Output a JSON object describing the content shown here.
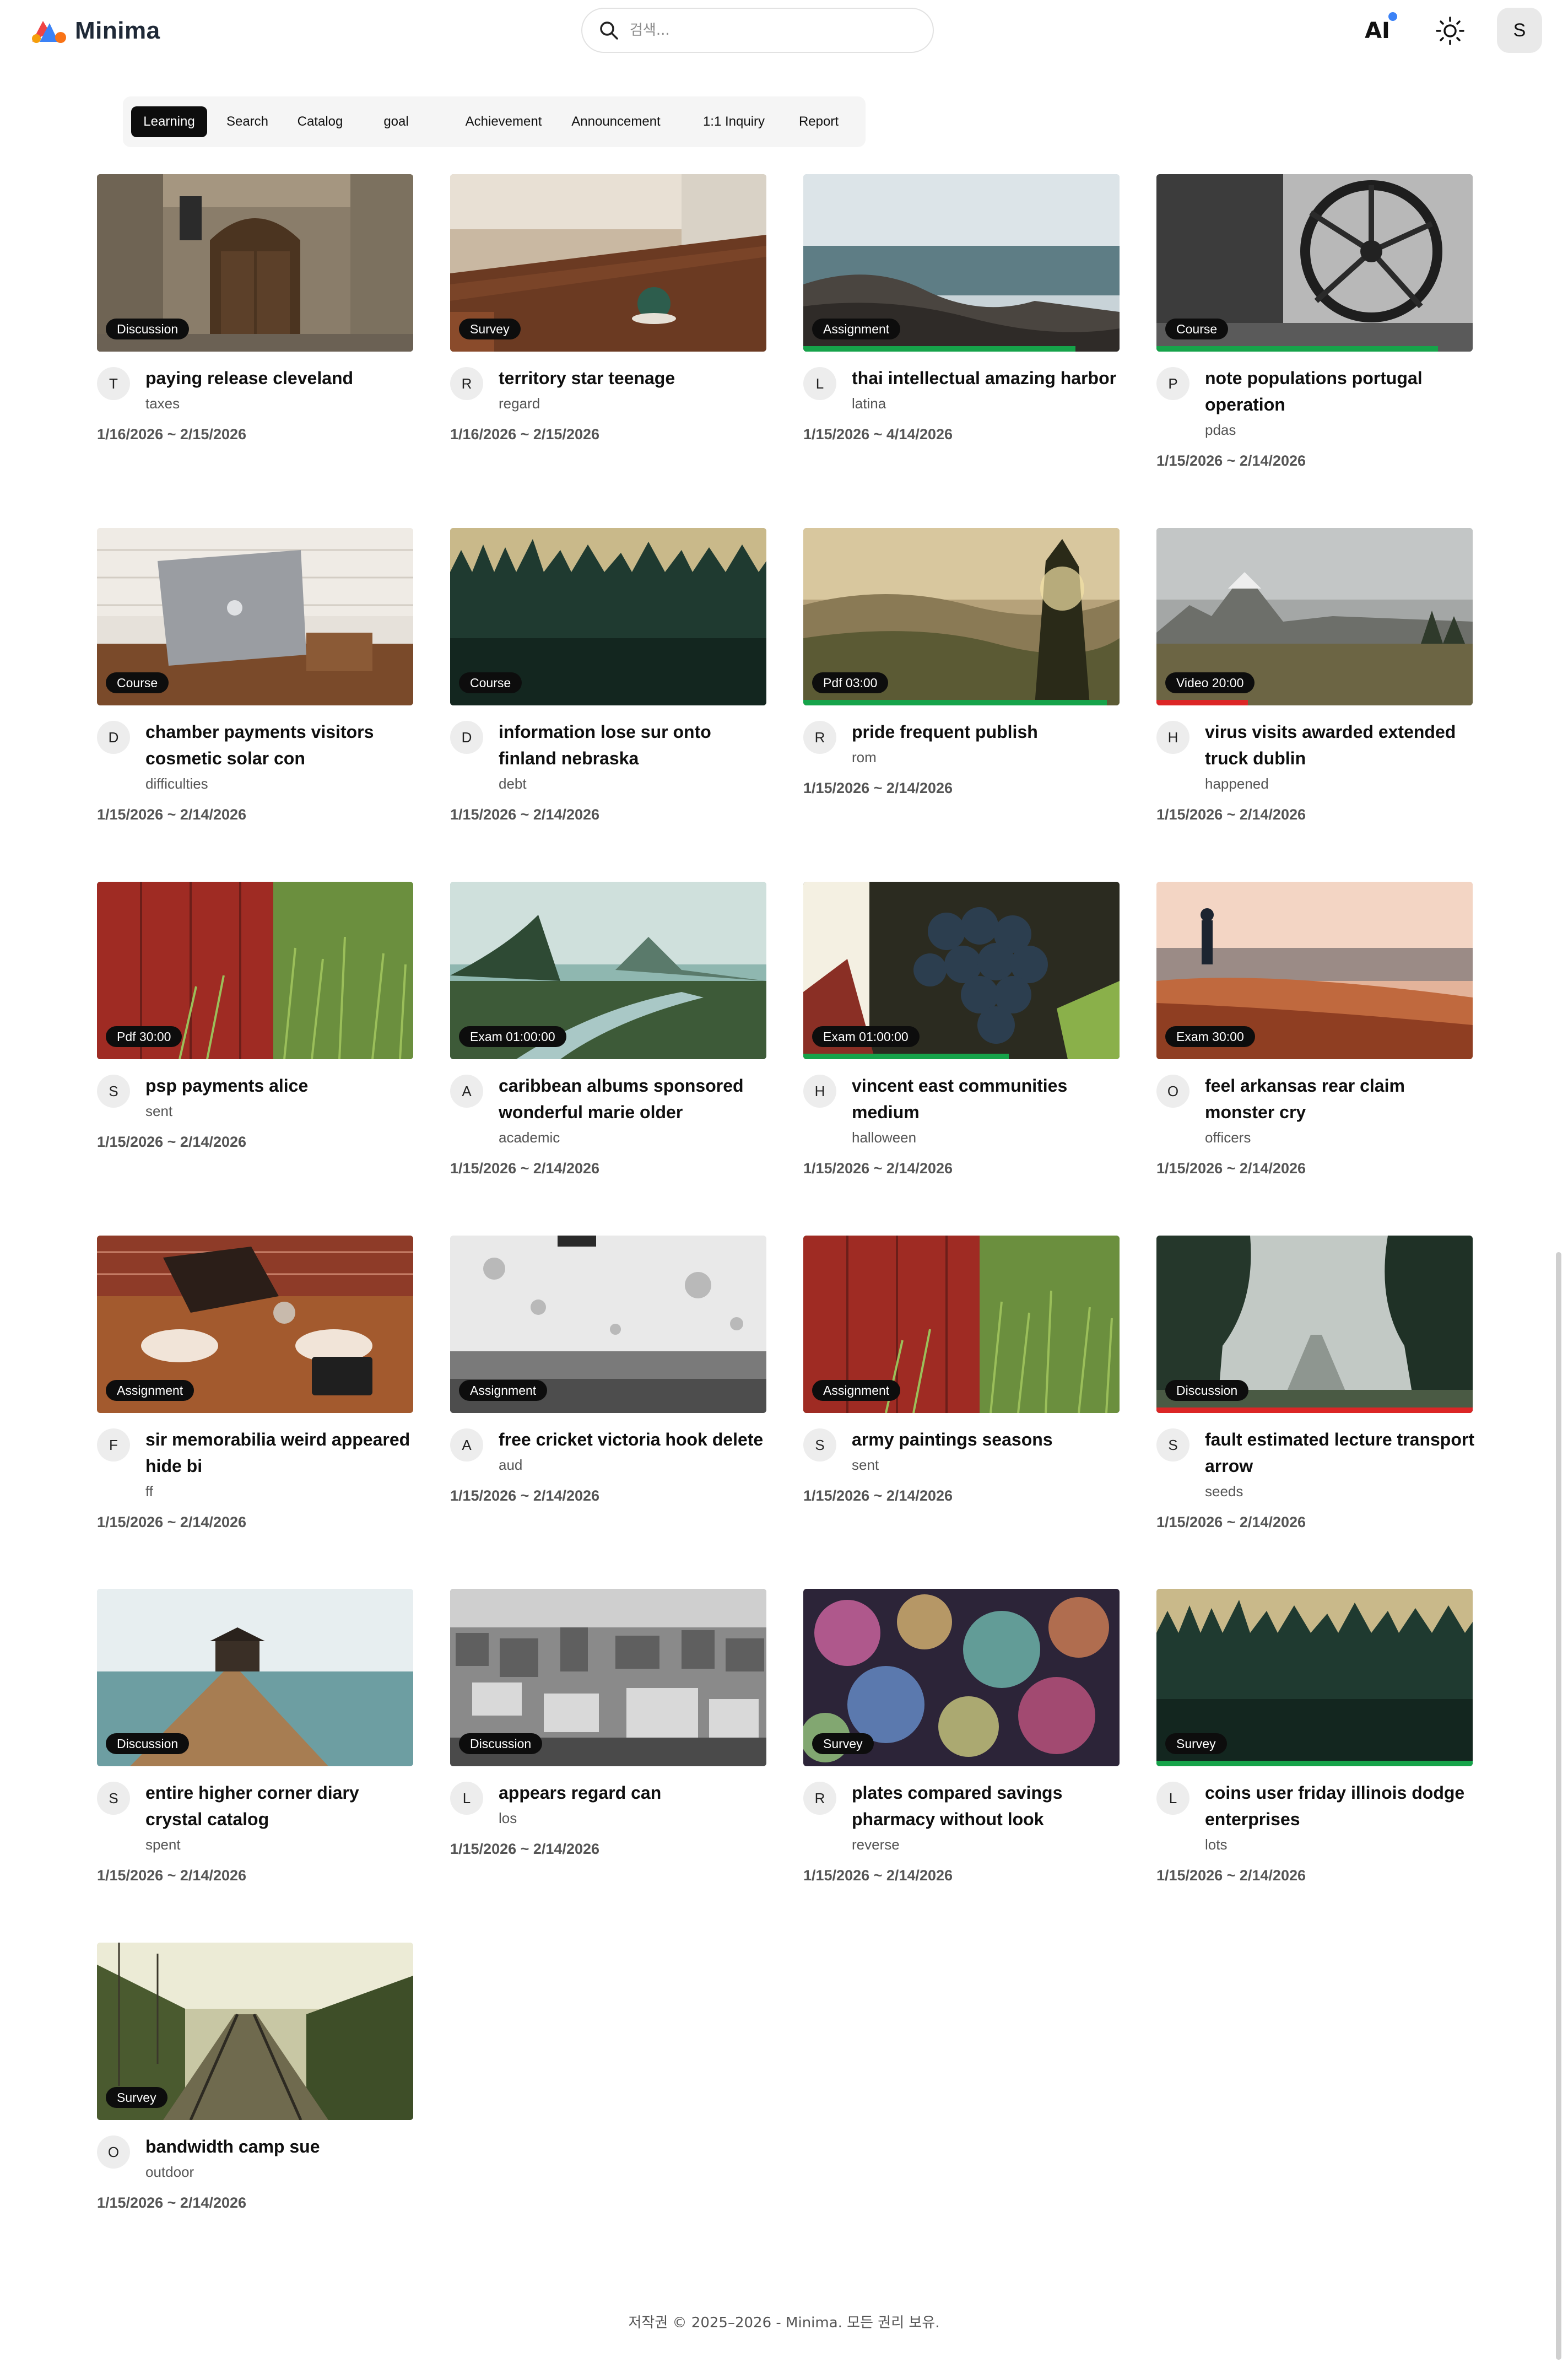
{
  "app": {
    "name": "Minima"
  },
  "search": {
    "placeholder": "검색..."
  },
  "header": {
    "ai_label": "AI",
    "avatar_initial": "S"
  },
  "tabs": [
    {
      "label": "Learning",
      "active": true
    },
    {
      "label": "Search",
      "active": false
    },
    {
      "label": "Catalog",
      "active": false
    },
    {
      "label": "goal",
      "active": false
    },
    {
      "label": "Achievement",
      "active": false
    },
    {
      "label": "Announcement",
      "active": false
    },
    {
      "label": "1:1 Inquiry",
      "active": false
    },
    {
      "label": "Report",
      "active": false
    }
  ],
  "cards": [
    {
      "badge": "Discussion",
      "letter": "T",
      "title": "paying release cleveland",
      "subtitle": "taxes",
      "dates": "1/16/2026 ~ 2/15/2026",
      "image": "door"
    },
    {
      "badge": "Survey",
      "letter": "R",
      "title": "territory star teenage",
      "subtitle": "regard",
      "dates": "1/16/2026 ~ 2/15/2026",
      "image": "cafe"
    },
    {
      "badge": "Assignment",
      "letter": "L",
      "title": "thai intellectual amazing harbor",
      "subtitle": "latina",
      "dates": "1/15/2026 ~ 4/14/2026",
      "image": "sea",
      "progress": 0.86,
      "progress_color": "#16a34a"
    },
    {
      "badge": "Course",
      "letter": "P",
      "title": "note populations portugal operation",
      "subtitle": "pdas",
      "dates": "1/15/2026 ~ 2/14/2026",
      "image": "wheel",
      "progress": 0.89,
      "progress_color": "#16a34a"
    },
    {
      "badge": "Course",
      "letter": "D",
      "title": "chamber payments visitors cosmetic solar con",
      "subtitle": "difficulties",
      "dates": "1/15/2026 ~ 2/14/2026",
      "image": "laptop"
    },
    {
      "badge": "Course",
      "letter": "D",
      "title": "information lose sur onto finland nebraska",
      "subtitle": "debt",
      "dates": "1/15/2026 ~ 2/14/2026",
      "image": "forest"
    },
    {
      "badge": "Pdf  03:00",
      "letter": "R",
      "title": "pride frequent publish",
      "subtitle": "rom",
      "dates": "1/15/2026 ~ 2/14/2026",
      "image": "hills",
      "progress": 0.96,
      "progress_color": "#16a34a"
    },
    {
      "badge": "Video  20:00",
      "letter": "H",
      "title": "virus visits awarded extended truck dublin",
      "subtitle": "happened",
      "dates": "1/15/2026 ~ 2/14/2026",
      "image": "mountain",
      "progress": 0.29,
      "progress_color": "#dc2626"
    },
    {
      "badge": "Pdf  30:00",
      "letter": "S",
      "title": "psp payments alice",
      "subtitle": "sent",
      "dates": "1/15/2026 ~ 2/14/2026",
      "image": "redgrass"
    },
    {
      "badge": "Exam  01:00:00",
      "letter": "A",
      "title": "caribbean albums sponsored wonderful marie older",
      "subtitle": "academic",
      "dates": "1/15/2026 ~ 2/14/2026",
      "image": "river"
    },
    {
      "badge": "Exam  01:00:00",
      "letter": "H",
      "title": "vincent east communities medium",
      "subtitle": "halloween",
      "dates": "1/15/2026 ~ 2/14/2026",
      "image": "grapes",
      "progress": 0.65,
      "progress_color": "#16a34a"
    },
    {
      "badge": "Exam  30:00",
      "letter": "O",
      "title": "feel arkansas rear claim monster cry",
      "subtitle": "officers",
      "dates": "1/15/2026 ~ 2/14/2026",
      "image": "beach"
    },
    {
      "badge": "Assignment",
      "letter": "F",
      "title": "sir memorabilia weird appeared hide bi",
      "subtitle": "ff",
      "dates": "1/15/2026 ~ 2/14/2026",
      "image": "table"
    },
    {
      "badge": "Assignment",
      "letter": "A",
      "title": "free cricket victoria hook delete",
      "subtitle": "aud",
      "dates": "1/15/2026 ~ 2/14/2026",
      "image": "wall"
    },
    {
      "badge": "Assignment",
      "letter": "S",
      "title": "army paintings seasons",
      "subtitle": "sent",
      "dates": "1/15/2026 ~ 2/14/2026",
      "image": "redgrass"
    },
    {
      "badge": "Discussion",
      "letter": "S",
      "title": "fault estimated lecture transport arrow",
      "subtitle": "seeds",
      "dates": "1/15/2026 ~ 2/14/2026",
      "image": "trees",
      "progress": 1.0,
      "progress_color": "#dc2626"
    },
    {
      "badge": "Discussion",
      "letter": "S",
      "title": "entire higher corner diary crystal catalog",
      "subtitle": "spent",
      "dates": "1/15/2026 ~ 2/14/2026",
      "image": "pier"
    },
    {
      "badge": "Discussion",
      "letter": "L",
      "title": "appears regard can",
      "subtitle": "los",
      "dates": "1/15/2026 ~ 2/14/2026",
      "image": "city"
    },
    {
      "badge": "Survey",
      "letter": "R",
      "title": "plates compared savings pharmacy without look",
      "subtitle": "reverse",
      "dates": "1/15/2026 ~ 2/14/2026",
      "image": "bokeh"
    },
    {
      "badge": "Survey",
      "letter": "L",
      "title": "coins user friday illinois dodge enterprises",
      "subtitle": "lots",
      "dates": "1/15/2026 ~ 2/14/2026",
      "image": "forest",
      "progress": 1.0,
      "progress_color": "#16a34a"
    },
    {
      "badge": "Survey",
      "letter": "O",
      "title": "bandwidth camp sue",
      "subtitle": "outdoor",
      "dates": "1/15/2026 ~ 2/14/2026",
      "image": "tracks"
    }
  ],
  "footer": {
    "text": "저작권 © 2025–2026 - Minima. 모든 권리 보유."
  }
}
